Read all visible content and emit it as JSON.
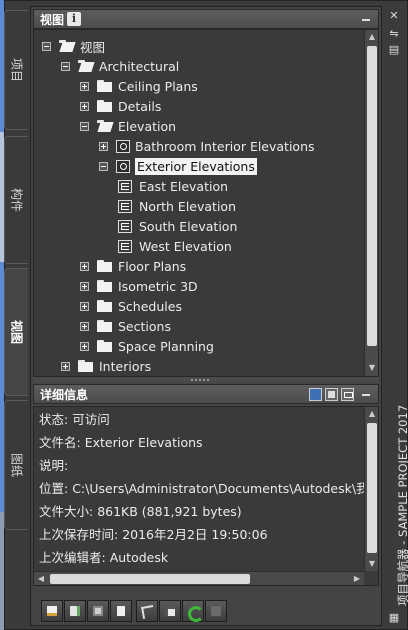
{
  "palette_title": "项目导航器 - SAMPLE PROJECT 2017",
  "vertical_tabs": [
    {
      "label": "项目",
      "active": false
    },
    {
      "label": "构件",
      "active": false
    },
    {
      "label": "视图",
      "active": true
    },
    {
      "label": "图纸",
      "active": false
    }
  ],
  "views_panel": {
    "title": "视图",
    "info_icon": "i"
  },
  "tree": [
    {
      "label": "视图",
      "level": 0,
      "state": "expanded",
      "icon": "folder-open-icon"
    },
    {
      "label": "Architectural",
      "level": 1,
      "state": "expanded",
      "icon": "folder-open-icon"
    },
    {
      "label": "Ceiling Plans",
      "level": 2,
      "state": "collapsed",
      "icon": "folder-icon"
    },
    {
      "label": "Details",
      "level": 2,
      "state": "collapsed",
      "icon": "folder-icon"
    },
    {
      "label": "Elevation",
      "level": 2,
      "state": "expanded",
      "icon": "folder-open-icon"
    },
    {
      "label": "Bathroom Interior Elevations",
      "level": 3,
      "state": "collapsed",
      "icon": "view-icon"
    },
    {
      "label": "Exterior Elevations",
      "level": 3,
      "state": "expanded",
      "icon": "view-icon",
      "selected": true
    },
    {
      "label": "East Elevation",
      "level": 4,
      "state": "leaf",
      "icon": "elevation-icon"
    },
    {
      "label": "North Elevation",
      "level": 4,
      "state": "leaf",
      "icon": "elevation-icon"
    },
    {
      "label": "South Elevation",
      "level": 4,
      "state": "leaf",
      "icon": "elevation-icon"
    },
    {
      "label": "West Elevation",
      "level": 4,
      "state": "leaf",
      "icon": "elevation-icon"
    },
    {
      "label": "Floor Plans",
      "level": 2,
      "state": "collapsed",
      "icon": "folder-icon"
    },
    {
      "label": "Isometric 3D",
      "level": 2,
      "state": "collapsed",
      "icon": "folder-icon"
    },
    {
      "label": "Schedules",
      "level": 2,
      "state": "collapsed",
      "icon": "folder-icon"
    },
    {
      "label": "Sections",
      "level": 2,
      "state": "collapsed",
      "icon": "folder-icon"
    },
    {
      "label": "Space Planning",
      "level": 2,
      "state": "collapsed",
      "icon": "folder-icon"
    },
    {
      "label": "Interiors",
      "level": 1,
      "state": "collapsed",
      "icon": "folder-icon"
    }
  ],
  "details_panel": {
    "title": "详细信息",
    "rows": [
      {
        "label": "状态:",
        "value": "可访问"
      },
      {
        "label": "文件名:",
        "value": "Exterior Elevations"
      },
      {
        "label": "说明:",
        "value": ""
      },
      {
        "label": "位置:",
        "value": "C:\\Users\\Administrator\\Documents\\Autodesk\\我的"
      },
      {
        "label": "文件大小:",
        "value": "861KB (881,921 bytes)"
      },
      {
        "label": "上次保存时间:",
        "value": "2016年2月2日  19:50:06"
      },
      {
        "label": "上次编辑者:",
        "value": "Autodesk"
      }
    ]
  },
  "toolbar_icons": [
    "new-view-icon",
    "new-section-icon",
    "new-detail-icon",
    "clipboard-icon",
    "properties-icon",
    "table-icon",
    "refresh-icon",
    "delete-icon"
  ],
  "accent_colors": {
    "panel_bg": "#3a3a3a",
    "selection_bg": "#f2f2f2",
    "refresh_green": "#3fb83a"
  }
}
